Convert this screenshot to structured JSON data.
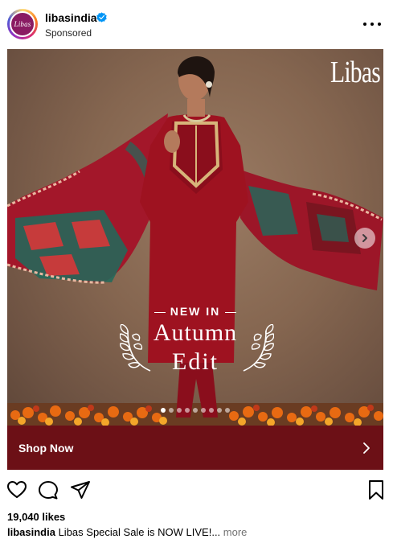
{
  "post": {
    "username": "libasindia",
    "sponsored_label": "Sponsored",
    "avatar_text": "Libas",
    "verified_icon": "verified-badge-icon",
    "menu_icon": "more-options-icon"
  },
  "creative": {
    "brand_logo": "Libas",
    "eyebrow": "NEW IN",
    "headline_line1": "Autumn",
    "headline_line2": "Edit",
    "carousel": {
      "total": 9,
      "active_index": 0
    },
    "next_icon": "chevron-right-icon"
  },
  "cta": {
    "label": "Shop Now",
    "icon": "chevron-right-icon",
    "color": "#6c1016"
  },
  "actions": {
    "like_icon": "heart-icon",
    "comment_icon": "comment-icon",
    "share_icon": "share-icon",
    "save_icon": "bookmark-icon"
  },
  "stats": {
    "likes": "19,040 likes"
  },
  "caption": {
    "username": "libasindia",
    "text": " Libas Special Sale is NOW LIVE!...",
    "more_label": " more"
  }
}
